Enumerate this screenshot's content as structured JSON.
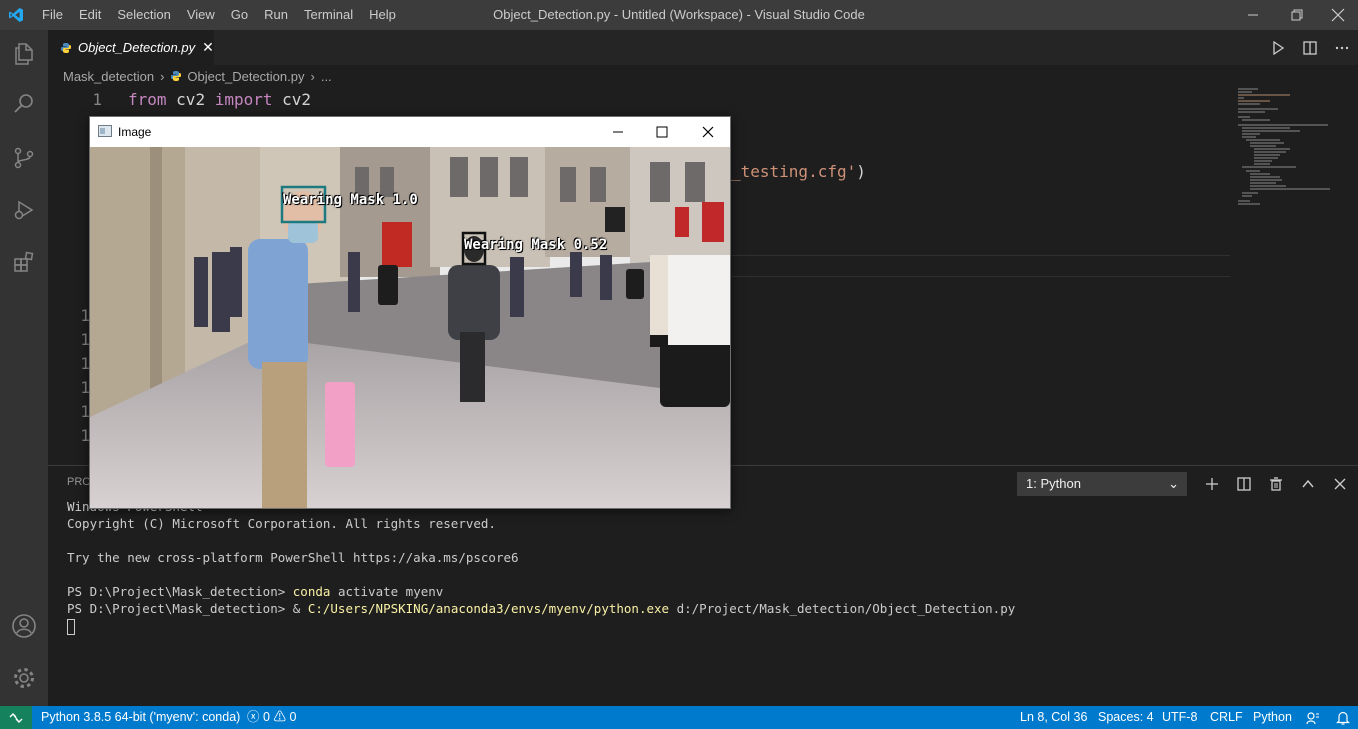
{
  "titlebar": {
    "menu": [
      "File",
      "Edit",
      "Selection",
      "View",
      "Go",
      "Run",
      "Terminal",
      "Help"
    ],
    "window_title": "Object_Detection.py - Untitled (Workspace) - Visual Studio Code"
  },
  "tab": {
    "label": "Object_Detection.py"
  },
  "breadcrumb": {
    "folder": "Mask_detection",
    "file": "Object_Detection.py",
    "more": "..."
  },
  "editor": {
    "line1_number": "1",
    "line1_from": "from",
    "line1_module": "cv2",
    "line1_import": "import",
    "line1_name": "cv2",
    "partial_string": "_testing.cfg'",
    "partial_paren": ")",
    "partial_numbers": [
      "1",
      "1",
      "1",
      "1",
      "1",
      "1"
    ]
  },
  "cv_window": {
    "title": "Image",
    "detections": [
      {
        "label": "Wearing Mask 1.0",
        "color": "#1f7a80"
      },
      {
        "label": "Wearing Mask 0.52",
        "color": "#111111"
      }
    ]
  },
  "panel": {
    "tab_partial": "PRO",
    "terminal_select": "1: Python",
    "terminal_lines": {
      "l0": "Windows PowerShell",
      "l1": "Copyright (C) Microsoft Corporation. All rights reserved.",
      "l2": "Try the new cross-platform PowerShell https://aka.ms/pscore6",
      "l3_prompt": "PS D:\\Project\\Mask_detection> ",
      "l3_cmd": "conda",
      "l3_rest": " activate myenv",
      "l4_prompt": "PS D:\\Project\\Mask_detection> & ",
      "l4_path": "C:/Users/NPSKING/anaconda3/envs/myenv/python.exe",
      "l4_rest": " d:/Project/Mask_detection/Object_Detection.py"
    }
  },
  "statusbar": {
    "interpreter": "Python 3.8.5 64-bit ('myenv': conda)",
    "errors": "0",
    "warnings": "0",
    "position": "Ln 8, Col 36",
    "spaces": "Spaces: 4",
    "encoding": "UTF-8",
    "eol": "CRLF",
    "language": "Python"
  },
  "colors": {
    "accent": "#007acc",
    "remote": "#16825d"
  }
}
